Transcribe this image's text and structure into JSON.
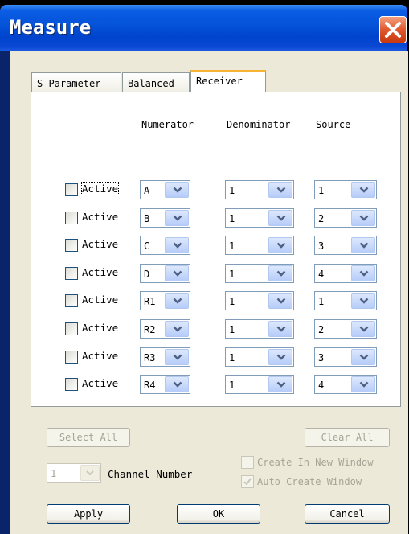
{
  "window": {
    "title": "Measure"
  },
  "tabs": [
    {
      "label": "S Parameter",
      "active": false
    },
    {
      "label": "Balanced",
      "active": false
    },
    {
      "label": "Receiver",
      "active": true
    }
  ],
  "columns": {
    "numerator": "Numerator",
    "denominator": "Denominator",
    "source": "Source"
  },
  "rows": [
    {
      "label": "Active",
      "checked": false,
      "numerator": "A",
      "denominator": "1",
      "source": "1"
    },
    {
      "label": "Active",
      "checked": false,
      "numerator": "B",
      "denominator": "1",
      "source": "2"
    },
    {
      "label": "Active",
      "checked": false,
      "numerator": "C",
      "denominator": "1",
      "source": "3"
    },
    {
      "label": "Active",
      "checked": false,
      "numerator": "D",
      "denominator": "1",
      "source": "4"
    },
    {
      "label": "Active",
      "checked": false,
      "numerator": "R1",
      "denominator": "1",
      "source": "1"
    },
    {
      "label": "Active",
      "checked": false,
      "numerator": "R2",
      "denominator": "1",
      "source": "2"
    },
    {
      "label": "Active",
      "checked": false,
      "numerator": "R3",
      "denominator": "1",
      "source": "3"
    },
    {
      "label": "Active",
      "checked": false,
      "numerator": "R4",
      "denominator": "1",
      "source": "4"
    }
  ],
  "buttons": {
    "select_all": "Select All",
    "clear_all": "Clear All",
    "apply": "Apply",
    "ok": "OK",
    "cancel": "Cancel"
  },
  "channel": {
    "value": "1",
    "label": "Channel Number"
  },
  "options": {
    "create_new_window": "Create In New Window",
    "auto_create_window": "Auto Create Window"
  },
  "colors": {
    "title_bar": "#0452d8",
    "close_button": "#e0582c",
    "active_tab_accent": "#f7b333",
    "dialog_bg": "#ece9d8"
  }
}
